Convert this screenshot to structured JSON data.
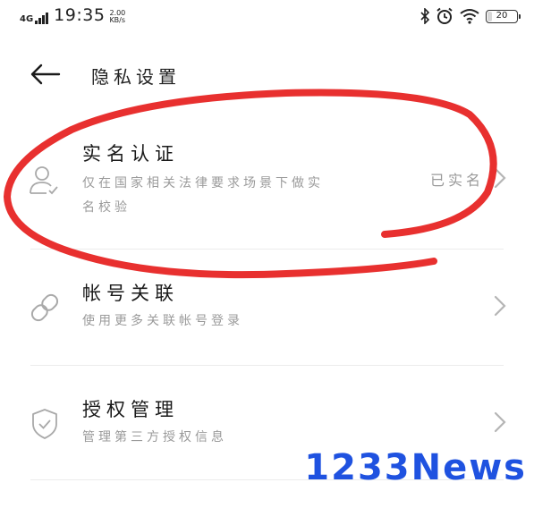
{
  "status_bar": {
    "network": "4G",
    "time": "19:35",
    "speed_value": "2.00",
    "speed_unit": "KB/s",
    "battery_level": "20",
    "icons": [
      "bluetooth-icon",
      "alarm-icon",
      "wifi-icon",
      "battery-icon"
    ]
  },
  "header": {
    "back_icon": "back-arrow-icon",
    "title": "隐私设置"
  },
  "items": [
    {
      "icon": "user-verified-icon",
      "title": "实名认证",
      "desc_line1": "仅在国家相关法律要求场景下做实",
      "desc_line2": "名校验",
      "value": "已实名"
    },
    {
      "icon": "link-icon",
      "title": "帐号关联",
      "desc_line1": "使用更多关联帐号登录"
    },
    {
      "icon": "shield-check-icon",
      "title": "授权管理",
      "desc_line1": "管理第三方授权信息"
    }
  ],
  "annotation_color": "#e8302f",
  "watermark": "1233News"
}
